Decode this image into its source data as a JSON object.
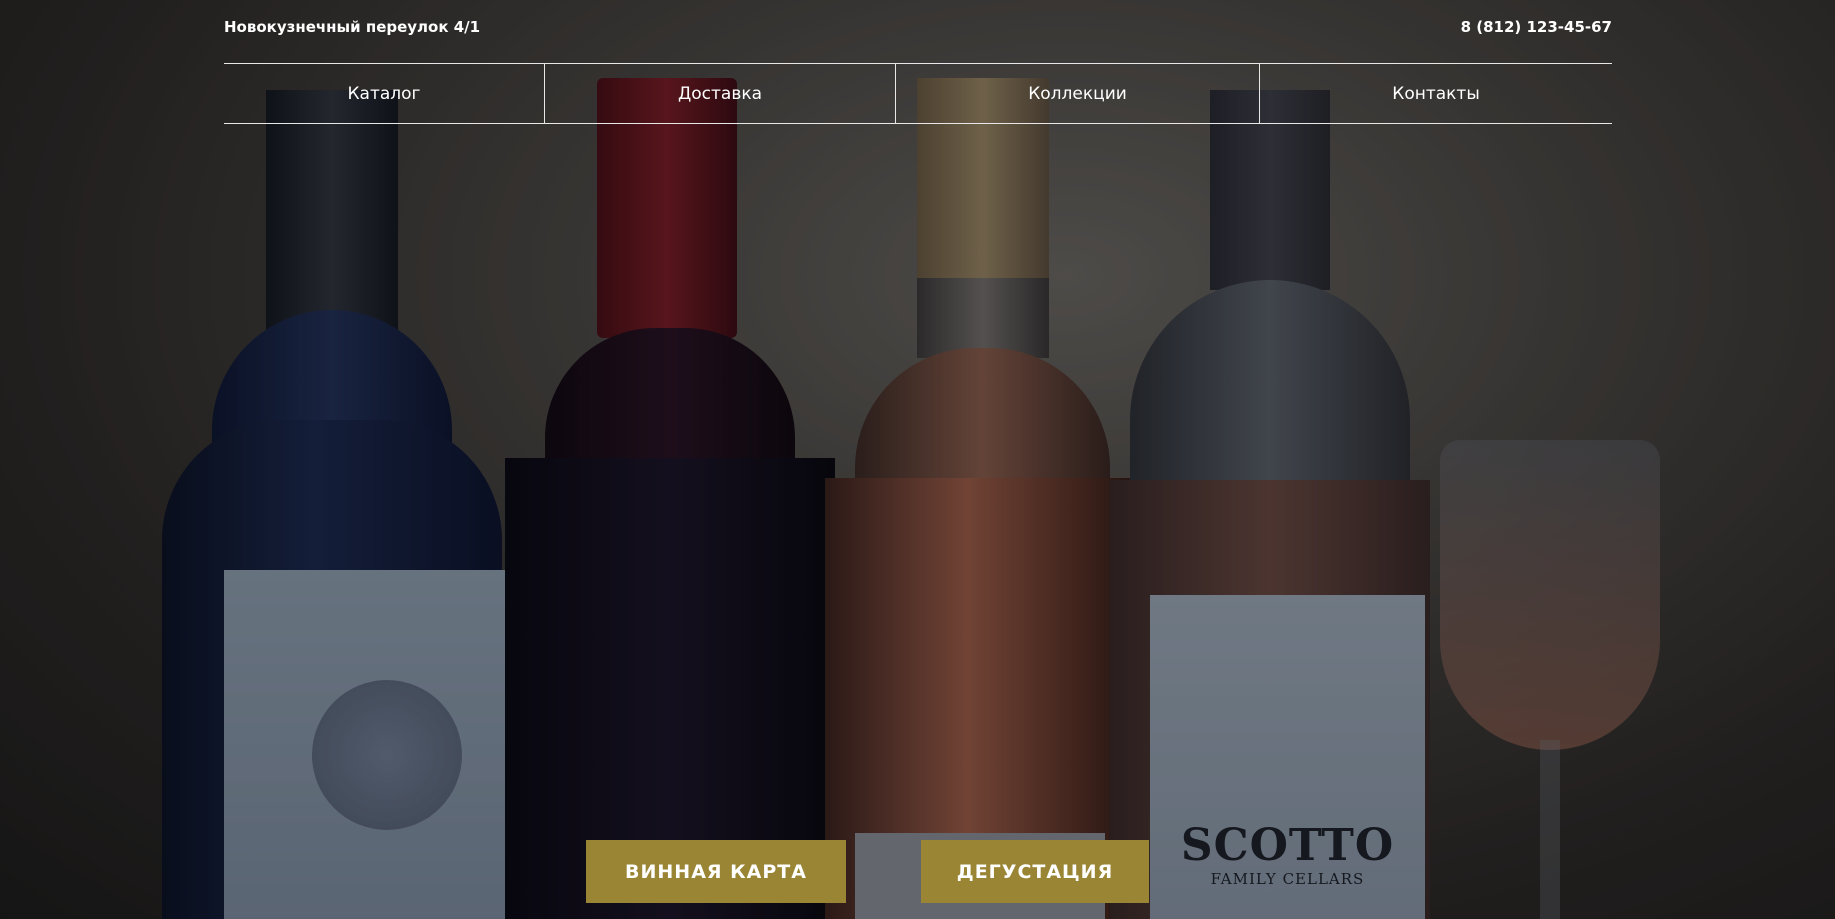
{
  "header": {
    "address": "Новокузнечный переулок 4/1",
    "phone": "8 (812) 123-45-67"
  },
  "nav": {
    "items": [
      {
        "label": "Каталог"
      },
      {
        "label": "Доставка"
      },
      {
        "label": "Коллекции"
      },
      {
        "label": "Контакты"
      }
    ]
  },
  "hero": {
    "bottle_label": "SCOTTO",
    "bottle_sublabel": "FAMILY CELLARS"
  },
  "actions": {
    "wine_list_label": "ВИННАЯ КАРТА",
    "tasting_label": "ДЕГУСТАЦИЯ"
  },
  "colors": {
    "accent": "#9a8535",
    "nav_border": "#e8e8e8",
    "text": "#ffffff"
  }
}
